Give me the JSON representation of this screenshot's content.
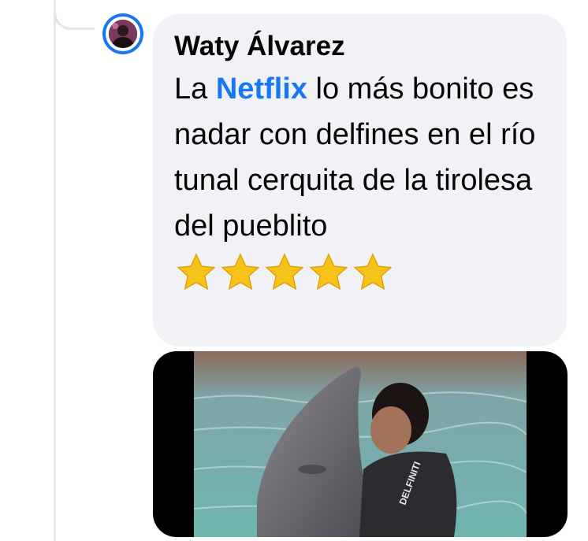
{
  "comment": {
    "author": "Waty Álvarez",
    "text_before": "La ",
    "mention": "Netflix",
    "text_after": " lo más bonito es nadar con delfines en el río tunal cerquita de la tirolesa del pueblito",
    "star_count": 5,
    "star_emoji": "star-emoji"
  },
  "colors": {
    "bubble_bg": "#f0f2f5",
    "mention": "#1877f2",
    "avatar_ring": "#1877f2",
    "thread_line": "#e4e6eb",
    "star": "#f7c21a"
  },
  "photo": {
    "vest_text": "DELFINITI"
  }
}
